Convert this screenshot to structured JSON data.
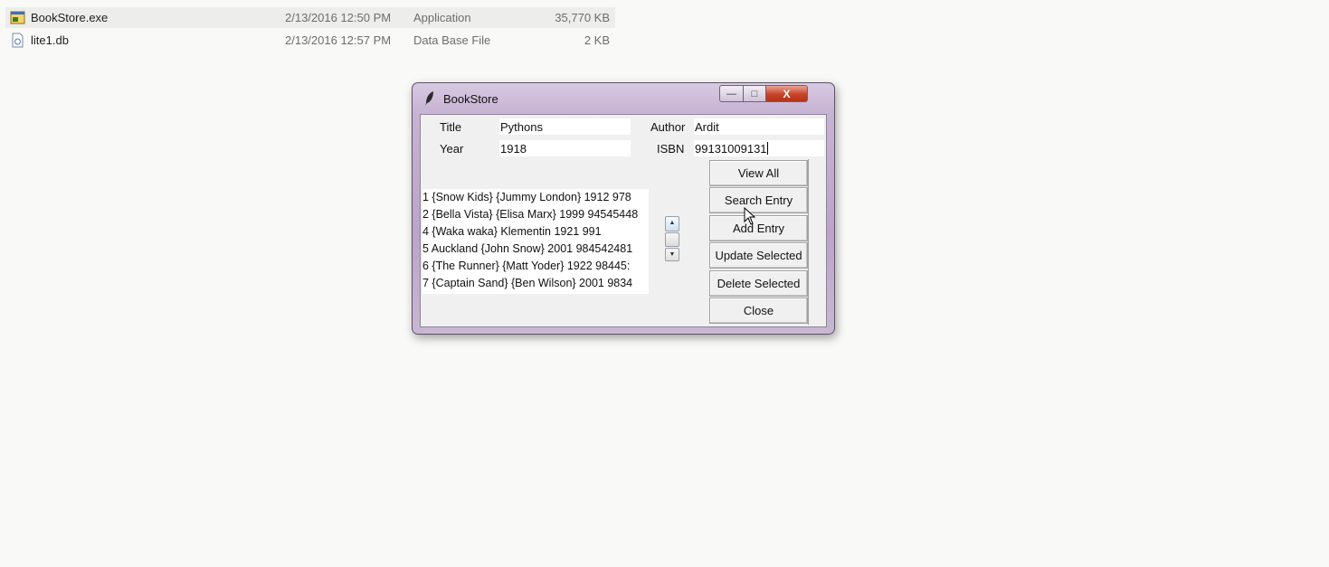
{
  "explorer": {
    "files": [
      {
        "icon": "exe-file-icon",
        "name": "BookStore.exe",
        "date": "2/13/2016 12:50 PM",
        "type": "Application",
        "size": "35,770 KB"
      },
      {
        "icon": "db-file-icon",
        "name": "lite1.db",
        "date": "2/13/2016 12:57 PM",
        "type": "Data Base File",
        "size": "2 KB"
      }
    ]
  },
  "window": {
    "title": "BookStore",
    "title_icon": "feather-icon",
    "controls": {
      "minimize": "—",
      "maximize": "□",
      "close": "X"
    },
    "colors": {
      "frame": "#c7b3d3",
      "close": "#c6442a"
    }
  },
  "form": {
    "title_label": "Title",
    "title_value": "Pythons",
    "author_label": "Author",
    "author_value": "Ardit",
    "year_label": "Year",
    "year_value": "1918",
    "isbn_label": "ISBN",
    "isbn_value": "99131009131"
  },
  "listbox": {
    "items": [
      "1 {Snow Kids} {Jummy London} 1912 978",
      "2 {Bella Vista} {Elisa Marx} 1999 94545448",
      "4 {Waka waka} Klementin 1921 991",
      "5 Auckland {John Snow} 2001 984542481",
      "6 {The Runner} {Matt Yoder} 1922 98445:",
      "7 {Captain Sand} {Ben Wilson} 2001 9834"
    ]
  },
  "buttons": {
    "view_all": "View All",
    "search_entry": "Search Entry",
    "add_entry": "Add Entry",
    "update_selected": "Update Selected",
    "delete_selected": "Delete Selected",
    "close": "Close"
  }
}
